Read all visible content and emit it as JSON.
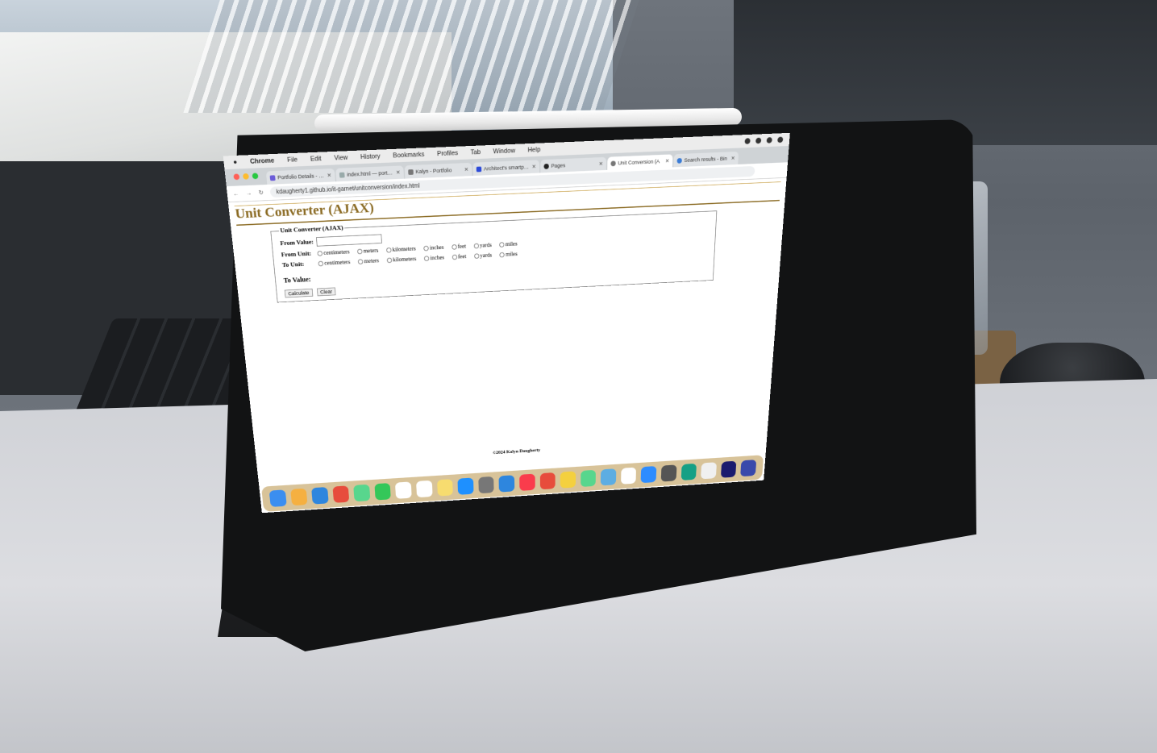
{
  "menubar": {
    "app": "Chrome",
    "items": [
      "File",
      "Edit",
      "View",
      "History",
      "Bookmarks",
      "Profiles",
      "Tab",
      "Window",
      "Help"
    ]
  },
  "tabs": [
    {
      "label": "Portfolio Details - Ka"
    },
    {
      "label": "index.html — portfoli"
    },
    {
      "label": "Kalyn - Portfolio"
    },
    {
      "label": "Architect's smartphon"
    },
    {
      "label": "Pages"
    },
    {
      "label": "Unit Conversion (A"
    },
    {
      "label": "Search results - Bin"
    }
  ],
  "url": "kdaugherty1.github.io/it-garnet/unitconversion/index.html",
  "page": {
    "title": "Unit Converter (AJAX)",
    "legend": "Unit Converter (AJAX)",
    "from_value_label": "From Value:",
    "from_unit_label": "From Unit:",
    "to_unit_label": "To Unit:",
    "to_value_label": "To Value:",
    "units": [
      "centimeters",
      "meters",
      "kilometers",
      "inches",
      "feet",
      "yards",
      "miles"
    ],
    "calculate": "Calculate",
    "clear": "Clear",
    "footer": "©2024 Kalyn Daugherty"
  },
  "dock": {
    "colors": [
      "#3b8ef0",
      "#f5b041",
      "#2e86de",
      "#e74c3c",
      "#58d68d",
      "#34c759",
      "#ffffff",
      "#ffffff",
      "#f7dc6f",
      "#1e90ff",
      "#777777",
      "#2e86de",
      "#fa3c4c",
      "#e74c3c",
      "#f4d03f",
      "#58d68d",
      "#5dade2",
      "#ffffff",
      "#2d8cff",
      "#555555",
      "#16a085",
      "#f0f0f0",
      "#1a1a6e",
      "#3949ab"
    ]
  }
}
